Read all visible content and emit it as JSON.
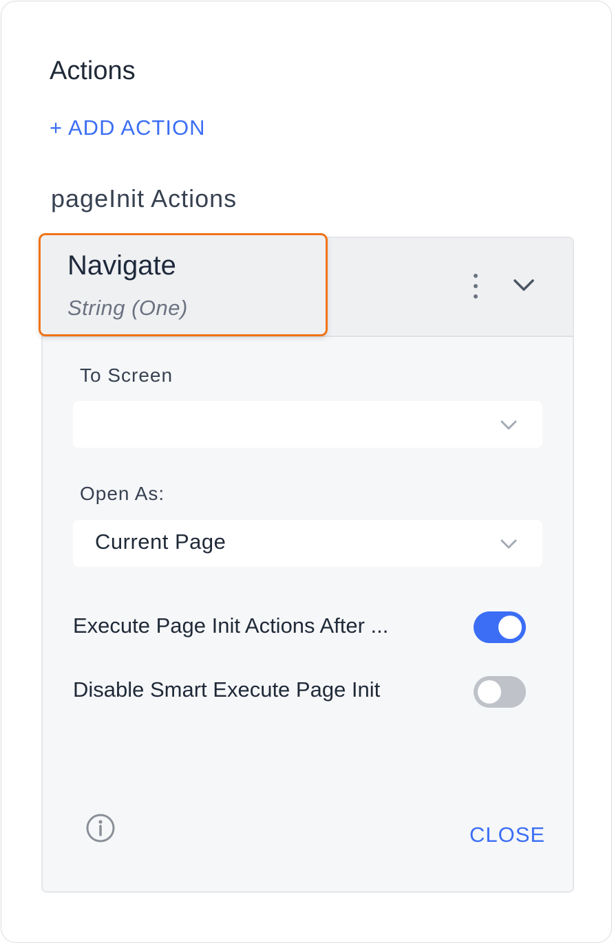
{
  "panel": {
    "title": "Actions",
    "add_action_label": "+ ADD ACTION",
    "section_label": "pageInit Actions"
  },
  "action": {
    "name": "Navigate",
    "type": "String (One)",
    "fields": {
      "to_screen": {
        "label": "To Screen",
        "value": ""
      },
      "open_as": {
        "label": "Open As:",
        "value": "Current Page"
      }
    },
    "toggles": [
      {
        "label": "Execute Page Init Actions After ...",
        "on": true
      },
      {
        "label": "Disable Smart Execute Page Init",
        "on": false
      }
    ],
    "close_label": "CLOSE"
  },
  "colors": {
    "accent": "#3b6ef5",
    "highlight": "#f07316",
    "toggle_off": "#bfc3c9"
  },
  "icons": [
    "kebab-menu-icon",
    "chevron-down-icon",
    "info-icon"
  ]
}
